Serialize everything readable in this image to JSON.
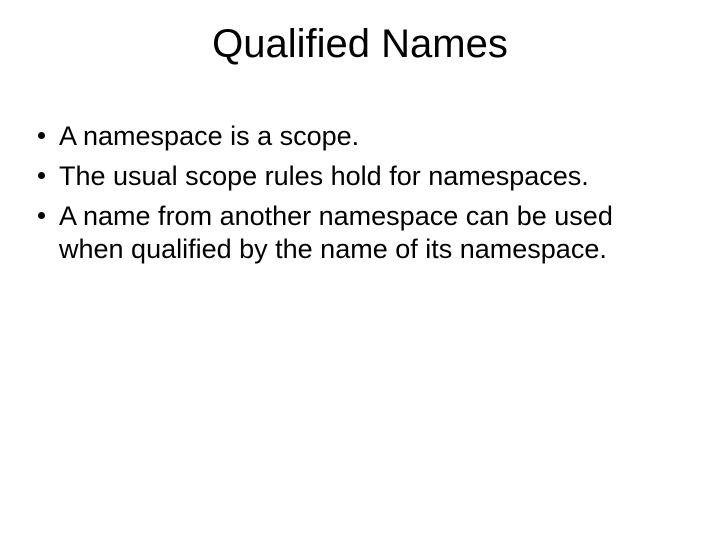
{
  "title": "Qualified Names",
  "bullets": [
    "A namespace is a scope.",
    "The usual scope rules hold for namespaces.",
    "A name from another namespace can be used when qualified by the name of its namespace."
  ]
}
